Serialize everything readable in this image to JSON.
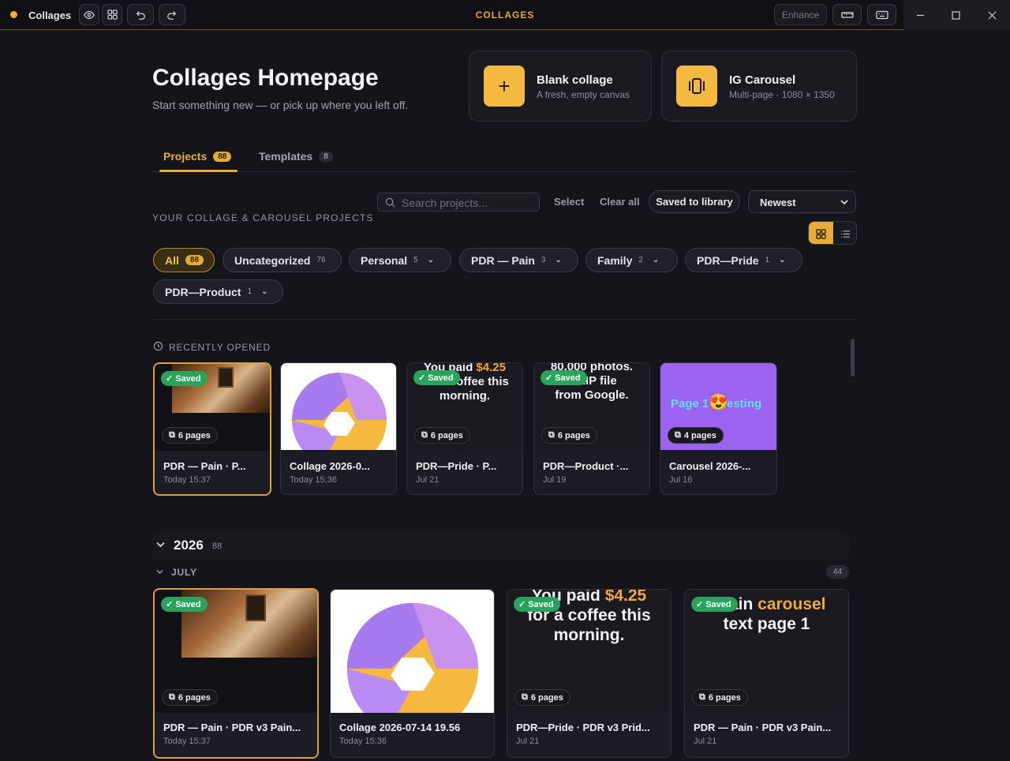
{
  "app": {
    "name": "Collages",
    "center_title": "COLLAGES",
    "enhance_label": "Enhance"
  },
  "hero": {
    "title": "Collages Homepage",
    "subtitle": "Start something new — or pick up where you left off."
  },
  "quick_actions": [
    {
      "title": "Blank collage",
      "subtitle": "A fresh, empty canvas",
      "icon": "plus-icon"
    },
    {
      "title": "IG Carousel",
      "subtitle": "Multi-page · 1080 × 1350",
      "icon": "carousel-icon"
    }
  ],
  "tabs": [
    {
      "label": "Projects",
      "count": "88",
      "active": true
    },
    {
      "label": "Templates",
      "count": "8",
      "active": false
    }
  ],
  "toolbar": {
    "search_placeholder": "Search projects...",
    "select_label": "Select",
    "clear_label": "Clear all",
    "saved_label": "Saved to library",
    "sort_value": "Newest"
  },
  "section_label": "YOUR COLLAGE & CAROUSEL PROJECTS",
  "filters": [
    {
      "label": "All",
      "count": "88",
      "active": true
    },
    {
      "label": "Uncategorized",
      "count": "76"
    },
    {
      "label": "Personal",
      "count": "5"
    },
    {
      "label": "PDR — Pain",
      "count": "3"
    },
    {
      "label": "Family",
      "count": "2"
    },
    {
      "label": "PDR—Pride",
      "count": "1"
    },
    {
      "label": "PDR—Product",
      "count": "1"
    }
  ],
  "recent": {
    "label": "RECENTLY OPENED",
    "items": [
      {
        "title": "PDR — Pain · P...",
        "date": "Today 15:37",
        "saved": "Saved",
        "pages": "6 pages"
      },
      {
        "title": "Collage 2026-0...",
        "date": "Today 15:36"
      },
      {
        "title": "PDR—Pride · P...",
        "date": "Jul 21",
        "saved": "Saved",
        "pages": "6 pages",
        "thumb_line1": "You paid",
        "thumb_price": "$4.25",
        "thumb_line2": "for a coffee this",
        "thumb_line3": "morning."
      },
      {
        "title": "PDR—Product ·...",
        "date": "Jul 19",
        "saved": "Saved",
        "pages": "6 pages",
        "thumb_line1": "80,000 photos.",
        "thumb_line2": "A ZIP file",
        "thumb_line3": "from Google."
      },
      {
        "title": "Carousel 2026-...",
        "date": "Jul 16",
        "pages": "4 pages",
        "thumb_text_a": "Page 1",
        "thumb_text_b": "esting",
        "emoji": "😍"
      }
    ]
  },
  "year_group": {
    "year": "2026",
    "count": "88",
    "month": "JULY",
    "month_count": "44"
  },
  "grid": [
    {
      "title": "PDR — Pain · PDR v3 Pain...",
      "date": "Today 15:37",
      "saved": "Saved",
      "pages": "6 pages"
    },
    {
      "title": "Collage 2026-07-14 19.56",
      "date": "Today 15:36"
    },
    {
      "title": "PDR—Pride · PDR v3 Prid...",
      "date": "Jul 21",
      "saved": "Saved",
      "pages": "6 pages",
      "thumb_line1": "You paid",
      "thumb_price": "$4.25",
      "thumb_line2": "for a coffee this",
      "thumb_line3": "morning."
    },
    {
      "title": "PDR — Pain · PDR v3 Pain...",
      "date": "Jul 21",
      "saved": "Saved",
      "pages": "6 pages",
      "thumb_line1": "Main",
      "thumb_accent": "carousel",
      "thumb_line2": "text page 1"
    }
  ],
  "colors": {
    "accent": "#e6ad3a",
    "saved": "#2aa45c",
    "background": "#14141a"
  }
}
